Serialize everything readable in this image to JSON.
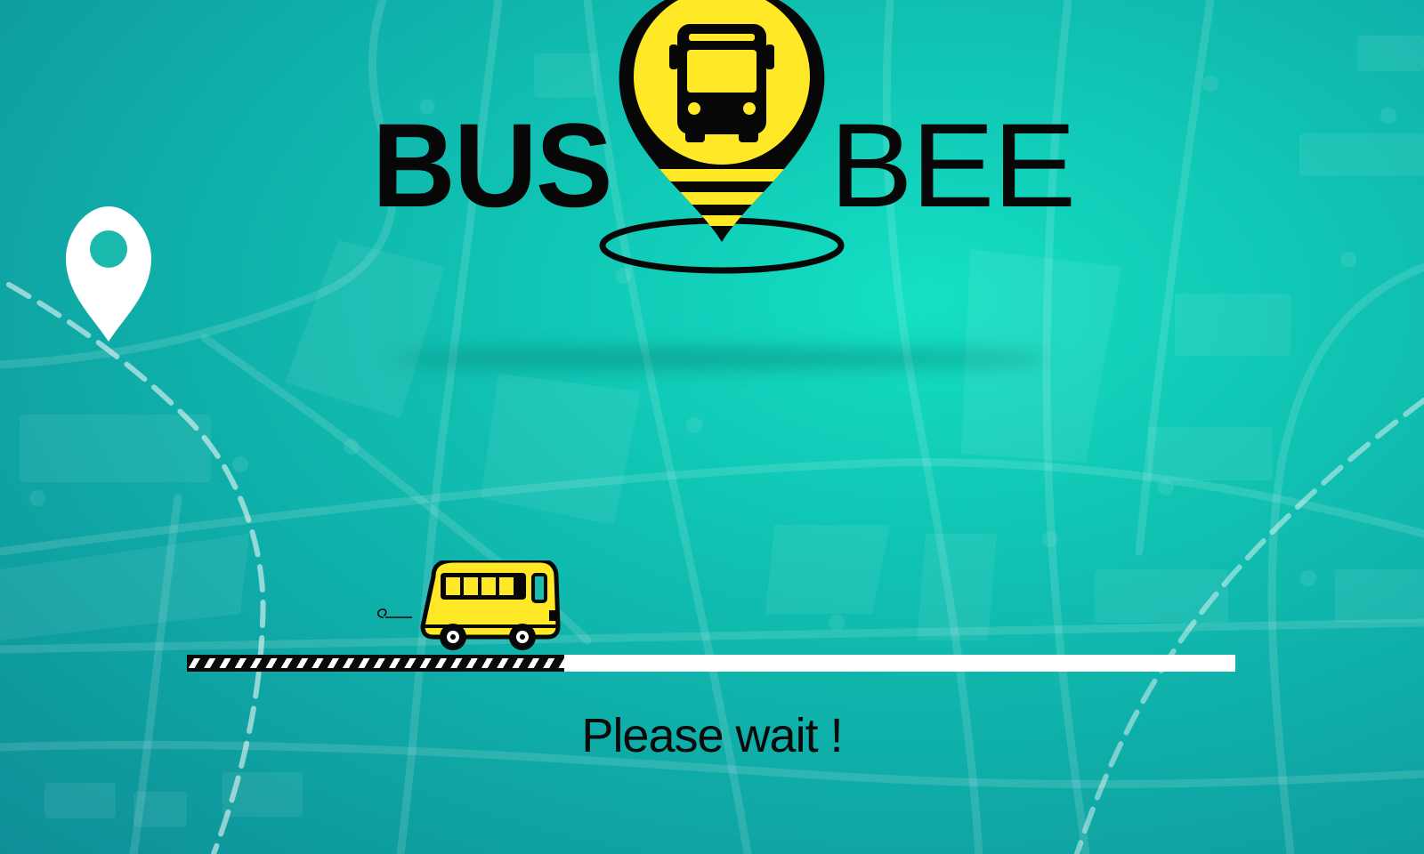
{
  "app": {
    "brand_left": "BUS",
    "brand_right": "BEE",
    "logo_icon": "bus-location-pin-icon"
  },
  "loader": {
    "progress": 0.36,
    "vehicle_icon": "school-bus-icon",
    "status_text": "Please wait !"
  },
  "background": {
    "map_icon": "map-pin-icon"
  },
  "colors": {
    "background_light": "#14e0c4",
    "background_dark": "#0e8f97",
    "brand_yellow": "#ffe927",
    "ink": "#070707",
    "track": "#ffffff"
  }
}
